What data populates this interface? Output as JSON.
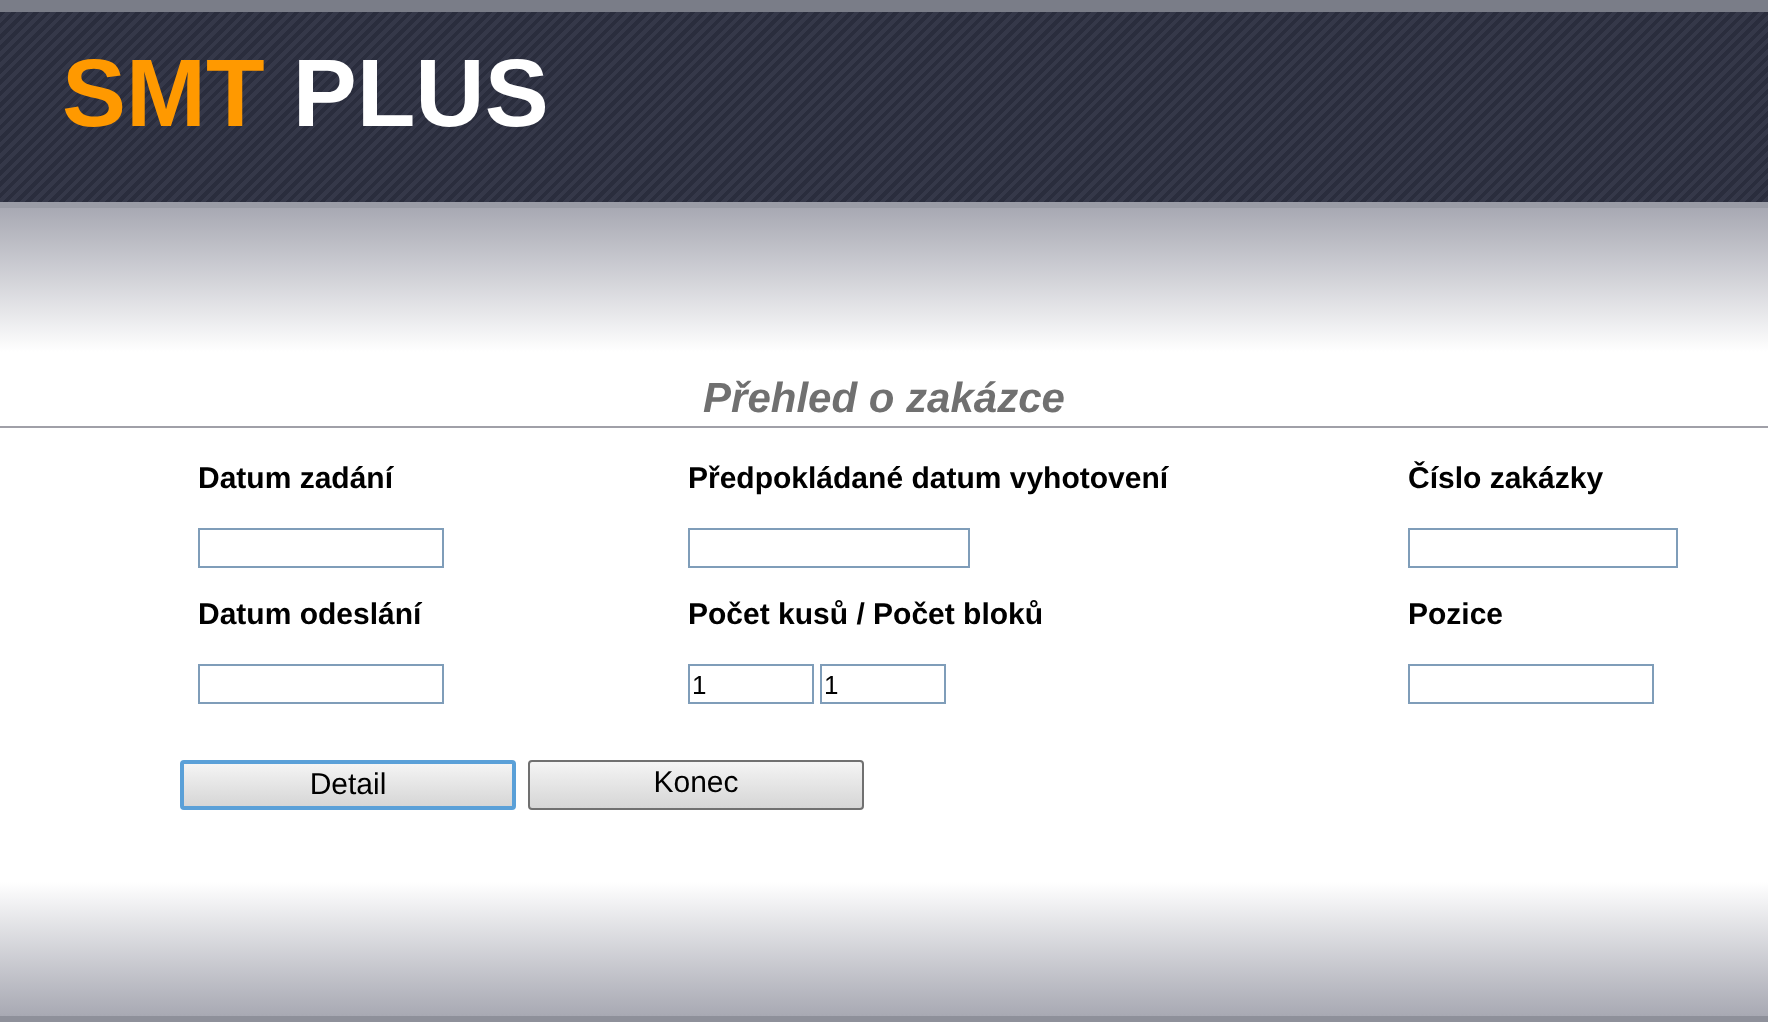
{
  "header": {
    "logo": [
      {
        "text": "SMT",
        "color": "#ff9900"
      },
      {
        "text": "PLUS",
        "color": "#ffffff"
      }
    ]
  },
  "title": "Přehled o zakázce",
  "fields": [
    {
      "label": "Datum zadání"
    },
    {
      "label": "Předpokládané datum vyhotovení"
    },
    {
      "label": "Číslo zakázky"
    },
    {
      "label": "Datum odeslání"
    },
    {
      "label": "Počet kusů / Počet bloků",
      "values": [
        "1",
        "1"
      ]
    },
    {
      "label": "Pozice"
    }
  ],
  "buttons": [
    {
      "label": "Detail",
      "focused": true
    },
    {
      "label": "Konec",
      "focused": false
    }
  ]
}
